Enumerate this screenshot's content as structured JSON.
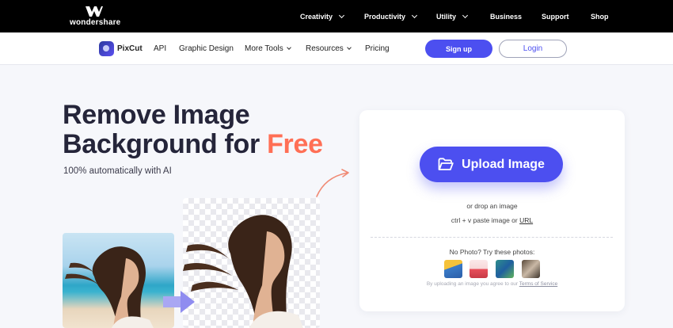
{
  "topbar": {
    "brand": "wondershare",
    "nav": [
      {
        "label": "Creativity",
        "dropdown": true
      },
      {
        "label": "Productivity",
        "dropdown": true
      },
      {
        "label": "Utility",
        "dropdown": true
      },
      {
        "label": "Business",
        "dropdown": false
      },
      {
        "label": "Support",
        "dropdown": false
      },
      {
        "label": "Shop",
        "dropdown": false
      }
    ]
  },
  "subnav": {
    "product": "PixCut",
    "items": [
      {
        "label": "API",
        "dropdown": false
      },
      {
        "label": "Graphic Design",
        "dropdown": false
      },
      {
        "label": "More Tools",
        "dropdown": true
      },
      {
        "label": "Resources",
        "dropdown": true
      },
      {
        "label": "Pricing",
        "dropdown": false
      }
    ],
    "signup_label": "Sign up",
    "login_label": "Login"
  },
  "hero": {
    "title_line1": "Remove Image",
    "title_line2_prefix": "Background for ",
    "title_highlight": "Free",
    "subtitle": "100% automatically with AI"
  },
  "upload": {
    "button_label": "Upload Image",
    "drop_text": "or drop an image",
    "paste_text": "ctrl + v paste image or ",
    "paste_link": "URL",
    "try_text": "No Photo? Try these photos:",
    "terms_text": "By uploading an image you agree to our ",
    "terms_link": "Terms of Service"
  },
  "colors": {
    "accent": "#4c4ff0",
    "highlight": "#ff6f55",
    "topbar": "#000000",
    "page_bg": "#f6f7fb"
  },
  "icons": [
    "wondershare-logo-icon",
    "pixcut-logo-icon",
    "folder-open-icon",
    "chevron-down-icon",
    "arrow-right-icon",
    "curved-arrow-icon"
  ]
}
